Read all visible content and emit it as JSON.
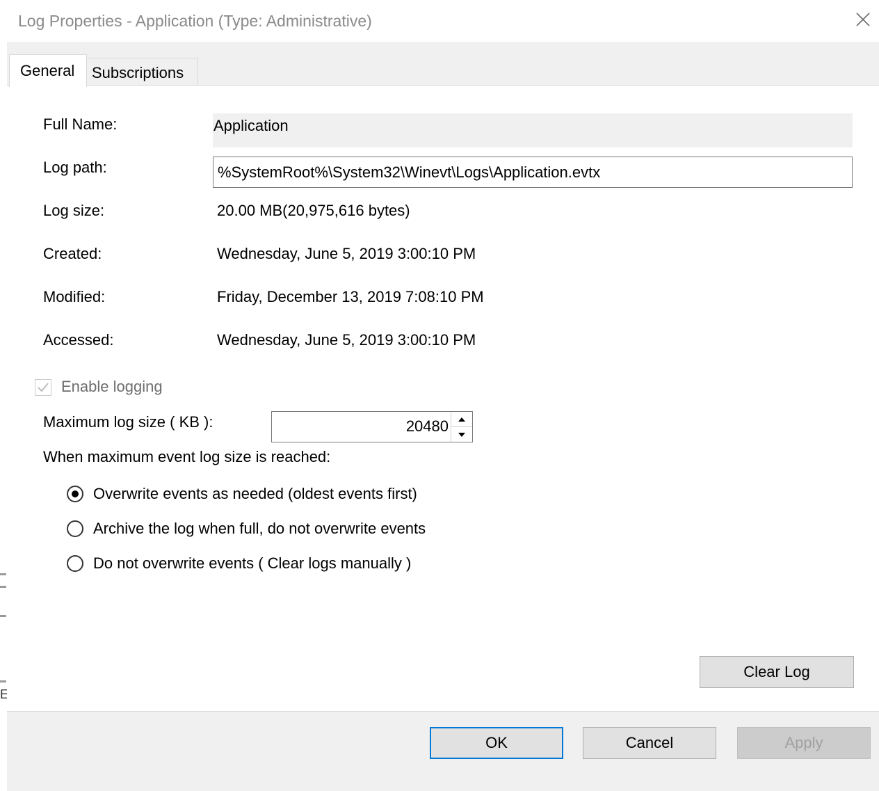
{
  "window": {
    "title": "Log Properties - Application (Type: Administrative)"
  },
  "tabs": [
    {
      "label": "General",
      "selected": true
    },
    {
      "label": "Subscriptions",
      "selected": false
    }
  ],
  "general": {
    "full_name_label": "Full Name:",
    "full_name_value": "Application",
    "log_path_label": "Log path:",
    "log_path_value": "%SystemRoot%\\System32\\Winevt\\Logs\\Application.evtx",
    "log_size_label": "Log size:",
    "log_size_value": "20.00 MB(20,975,616 bytes)",
    "created_label": "Created:",
    "created_value": "Wednesday, June 5, 2019 3:00:10 PM",
    "modified_label": "Modified:",
    "modified_value": "Friday, December 13, 2019 7:08:10 PM",
    "accessed_label": "Accessed:",
    "accessed_value": "Wednesday, June 5, 2019 3:00:10 PM",
    "enable_logging_label": "Enable logging",
    "enable_logging_checked": true,
    "max_size_label": "Maximum log size ( KB ):",
    "max_size_value": "20480",
    "when_reached_label": "When maximum event log size is reached:",
    "options": [
      {
        "label": "Overwrite events as needed (oldest events first)",
        "selected": true
      },
      {
        "label": "Archive the log when full, do not overwrite events",
        "selected": false
      },
      {
        "label": "Do not overwrite events ( Clear logs manually )",
        "selected": false
      }
    ],
    "clear_log_label": "Clear Log"
  },
  "footer": {
    "ok_label": "OK",
    "cancel_label": "Cancel",
    "apply_label": "Apply"
  },
  "background": {
    "edge_letter": "E"
  },
  "icons": {
    "close": "close-icon",
    "check": "checkmark-icon",
    "spin_up": "caret-up-icon",
    "spin_down": "caret-down-icon"
  },
  "colors": {
    "focus_border": "#0078d7",
    "dialog_bg": "#f0f0f0",
    "title_text": "#8a8a8a",
    "disabled_text": "#a0a0a0"
  }
}
